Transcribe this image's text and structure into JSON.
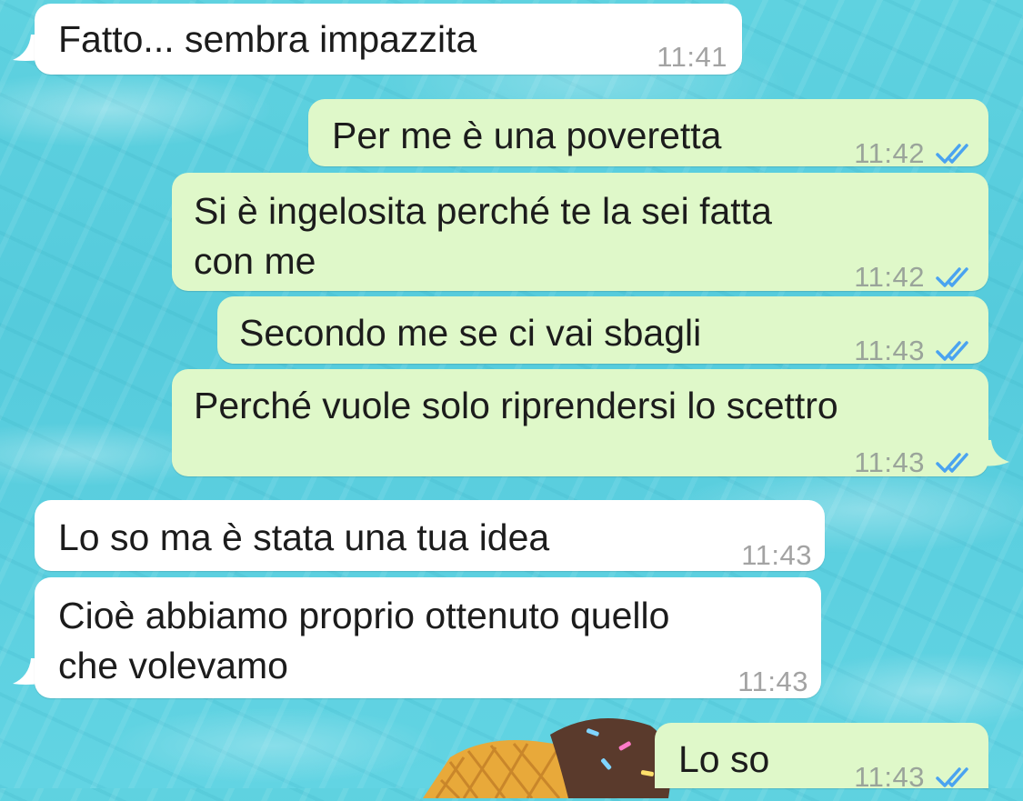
{
  "colors": {
    "incoming_bubble": "#ffffff",
    "outgoing_bubble": "#dff8c9",
    "read_check": "#4aa3f0",
    "time_text": "#9aa49a",
    "wallpaper": "#5fd2e0"
  },
  "messages": [
    {
      "direction": "in",
      "text": "Fatto... sembra impazzita",
      "time": "11:41",
      "read_icon": ""
    },
    {
      "direction": "out",
      "text": "Per me è una poveretta",
      "time": "11:42",
      "read_icon": "double-check-icon"
    },
    {
      "direction": "out",
      "text_line1": "Si è ingelosita perché te la sei fatta",
      "text_line2": "con me",
      "time": "11:42",
      "read_icon": "double-check-icon"
    },
    {
      "direction": "out",
      "text": "Secondo me se ci vai sbagli",
      "time": "11:43",
      "read_icon": "double-check-icon"
    },
    {
      "direction": "out",
      "text": "Perché vuole solo riprendersi lo scettro",
      "time": "11:43",
      "read_icon": "double-check-icon"
    },
    {
      "direction": "in",
      "text": "Lo so ma è stata una tua idea",
      "time": "11:43",
      "read_icon": ""
    },
    {
      "direction": "in",
      "text_line1": "Cioè abbiamo proprio ottenuto quello",
      "text_line2": "che volevamo",
      "time": "11:43",
      "read_icon": ""
    },
    {
      "direction": "out",
      "text": "Lo so",
      "time": "11:43",
      "read_icon": "double-check-icon"
    }
  ],
  "wallpaper_decoration": "ice-cream-float-icon"
}
